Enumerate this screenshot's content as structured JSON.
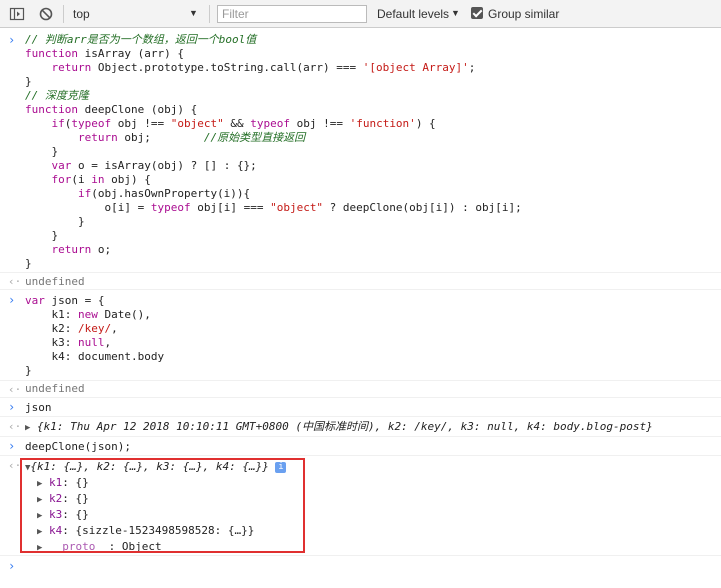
{
  "toolbar": {
    "context": "top",
    "filter_placeholder": "Filter",
    "levels": "Default levels",
    "group_similar": "Group similar"
  },
  "code_block_1": {
    "lines": [
      "// 判断arr是否为一个数组，返回一个bool值",
      "function isArray (arr) {",
      "    return Object.prototype.toString.call(arr) === '[object Array]';",
      "}",
      "// 深度克隆",
      "function deepClone (obj) {",
      "    if(typeof obj !== \"object\" && typeof obj !== 'function') {",
      "        return obj;        //原始类型直接返回",
      "    }",
      "    var o = isArray(obj) ? [] : {};",
      "    for(i in obj) {",
      "        if(obj.hasOwnProperty(i)){",
      "            o[i] = typeof obj[i] === \"object\" ? deepClone(obj[i]) : obj[i];",
      "        }",
      "    }",
      "    return o;",
      "}"
    ]
  },
  "result_1": "undefined",
  "code_block_2": {
    "lines": [
      "var json = {",
      "    k1: new Date(),",
      "    k2: /key/,",
      "    k3: null,",
      "    k4: document.body",
      "}"
    ]
  },
  "result_2": "undefined",
  "cmd_json": "json",
  "json_output": "{k1: Thu Apr 12 2018 10:10:11 GMT+0800 (中国标准时间), k2: /key/, k3: null, k4: body.blog-post}",
  "cmd_deepclone": "deepClone(json);",
  "clone_output": {
    "summary": "{k1: {…}, k2: {…}, k3: {…}, k4: {…}}",
    "info_icon": "i",
    "props": [
      {
        "key": "k1",
        "value": "{}"
      },
      {
        "key": "k2",
        "value": "{}"
      },
      {
        "key": "k3",
        "value": "{}"
      },
      {
        "key": "k4",
        "value": "{sizzle-1523498598528: {…}}"
      },
      {
        "key": "__proto__",
        "value": "Object"
      }
    ]
  },
  "icons": {
    "sidebar": "sidebar-toggle-icon",
    "clear": "clear-console-icon",
    "prompt": "prompt-chevron-icon",
    "result": "result-arrow-icon"
  }
}
